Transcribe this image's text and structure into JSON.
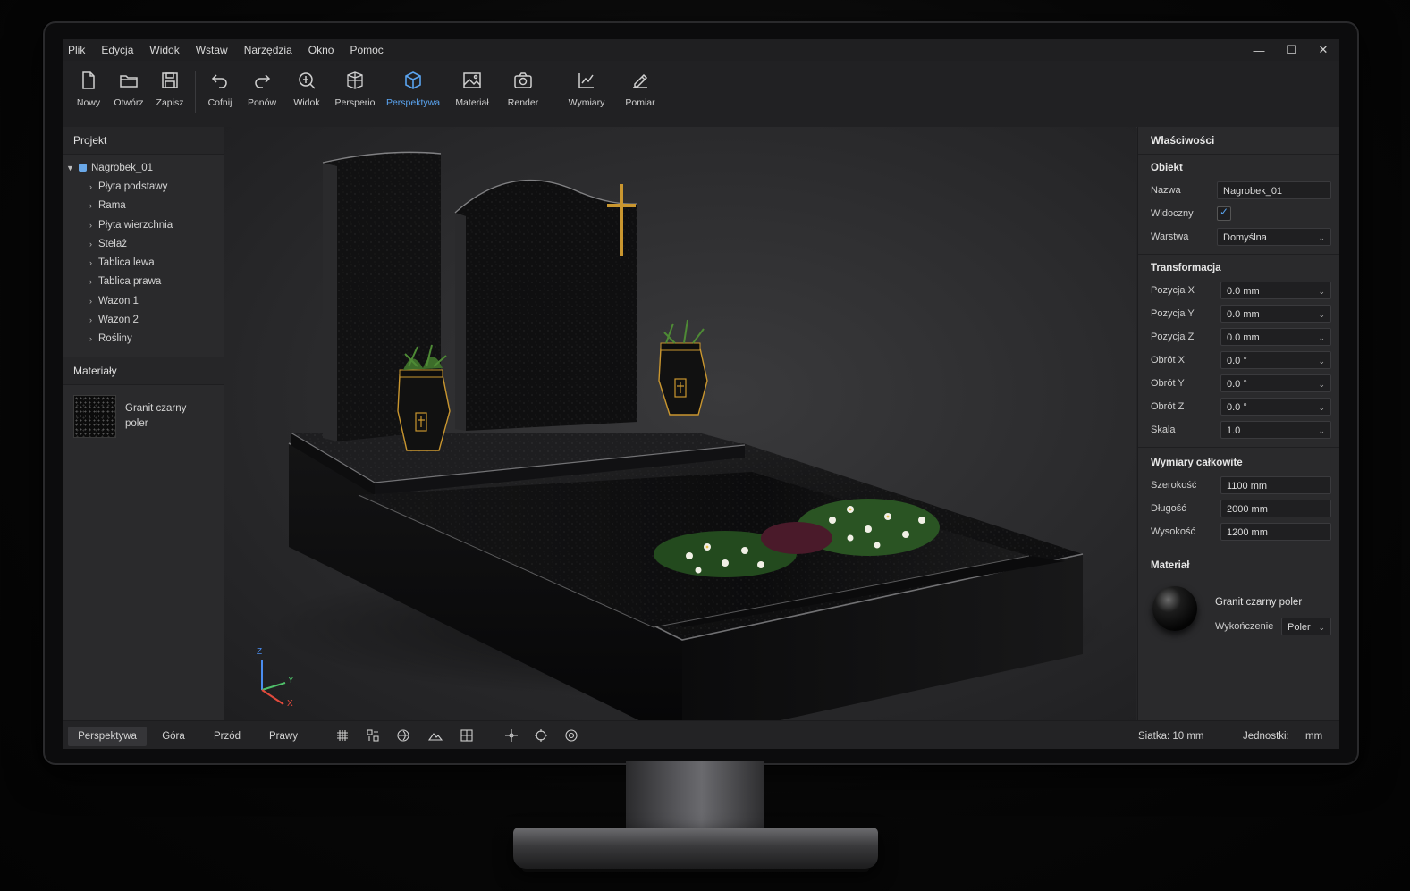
{
  "menu": [
    "Plik",
    "Edycja",
    "Widok",
    "Wstaw",
    "Narzędzia",
    "Okno",
    "Pomoc"
  ],
  "toolbar": {
    "new": "Nowy",
    "open": "Otwórz",
    "save": "Zapisz",
    "undo": "Cofnij",
    "redo": "Ponów",
    "view": "Widok",
    "persp_alt": "Persperio",
    "perspective": "Perspektywa",
    "material": "Materiał",
    "render": "Render",
    "dimensions": "Wymiary",
    "measure": "Pomiar",
    "accent": "#5aa4f0"
  },
  "left": {
    "project_title": "Projekt",
    "root": "Nagrobek_01",
    "items": [
      "Płyta podstawy",
      "Rama",
      "Płyta wierzchnia",
      "Stelaż",
      "Tablica lewa",
      "Tablica prawa",
      "Wazon 1",
      "Wazon 2",
      "Rośliny"
    ],
    "materials_title": "Materiały",
    "material_name": "Granit czarny poler"
  },
  "viewport": {
    "axis_z": "Z",
    "axis_y": "Y",
    "axis_x": "X"
  },
  "props": {
    "title": "Właściwości",
    "object_title": "Obiekt",
    "name_label": "Nazwa",
    "name_value": "Nagrobek_01",
    "visible_label": "Widoczny",
    "visible": true,
    "layer_label": "Warstwa",
    "layer_value": "Domyślna",
    "transform_title": "Transformacja",
    "pos_x_label": "Pozycja X",
    "pos_x": "0.0 mm",
    "pos_y_label": "Pozycja Y",
    "pos_y": "0.0 mm",
    "pos_z_label": "Pozycja Z",
    "pos_z": "0.0 mm",
    "rot_x_label": "Obrót X",
    "rot_x": "0.0 °",
    "rot_y_label": "Obrót Y",
    "rot_y": "0.0 °",
    "rot_z_label": "Obrót Z",
    "rot_z": "0.0 °",
    "scale_label": "Skala",
    "scale": "1.0",
    "dims_title": "Wymiary całkowite",
    "width_label": "Szerokość",
    "width": "1100 mm",
    "length_label": "Długość",
    "length": "2000 mm",
    "height_label": "Wysokość",
    "height": "1200 mm",
    "material_title": "Materiał",
    "material_name": "Granit czarny poler",
    "finish_label": "Wykończenie",
    "finish_value": "Poler"
  },
  "status": {
    "tabs": [
      "Perspektywa",
      "Góra",
      "Przód",
      "Prawy"
    ],
    "grid": "Siatka: 10 mm",
    "units_label": "Jednostki:",
    "units_value": "mm"
  }
}
